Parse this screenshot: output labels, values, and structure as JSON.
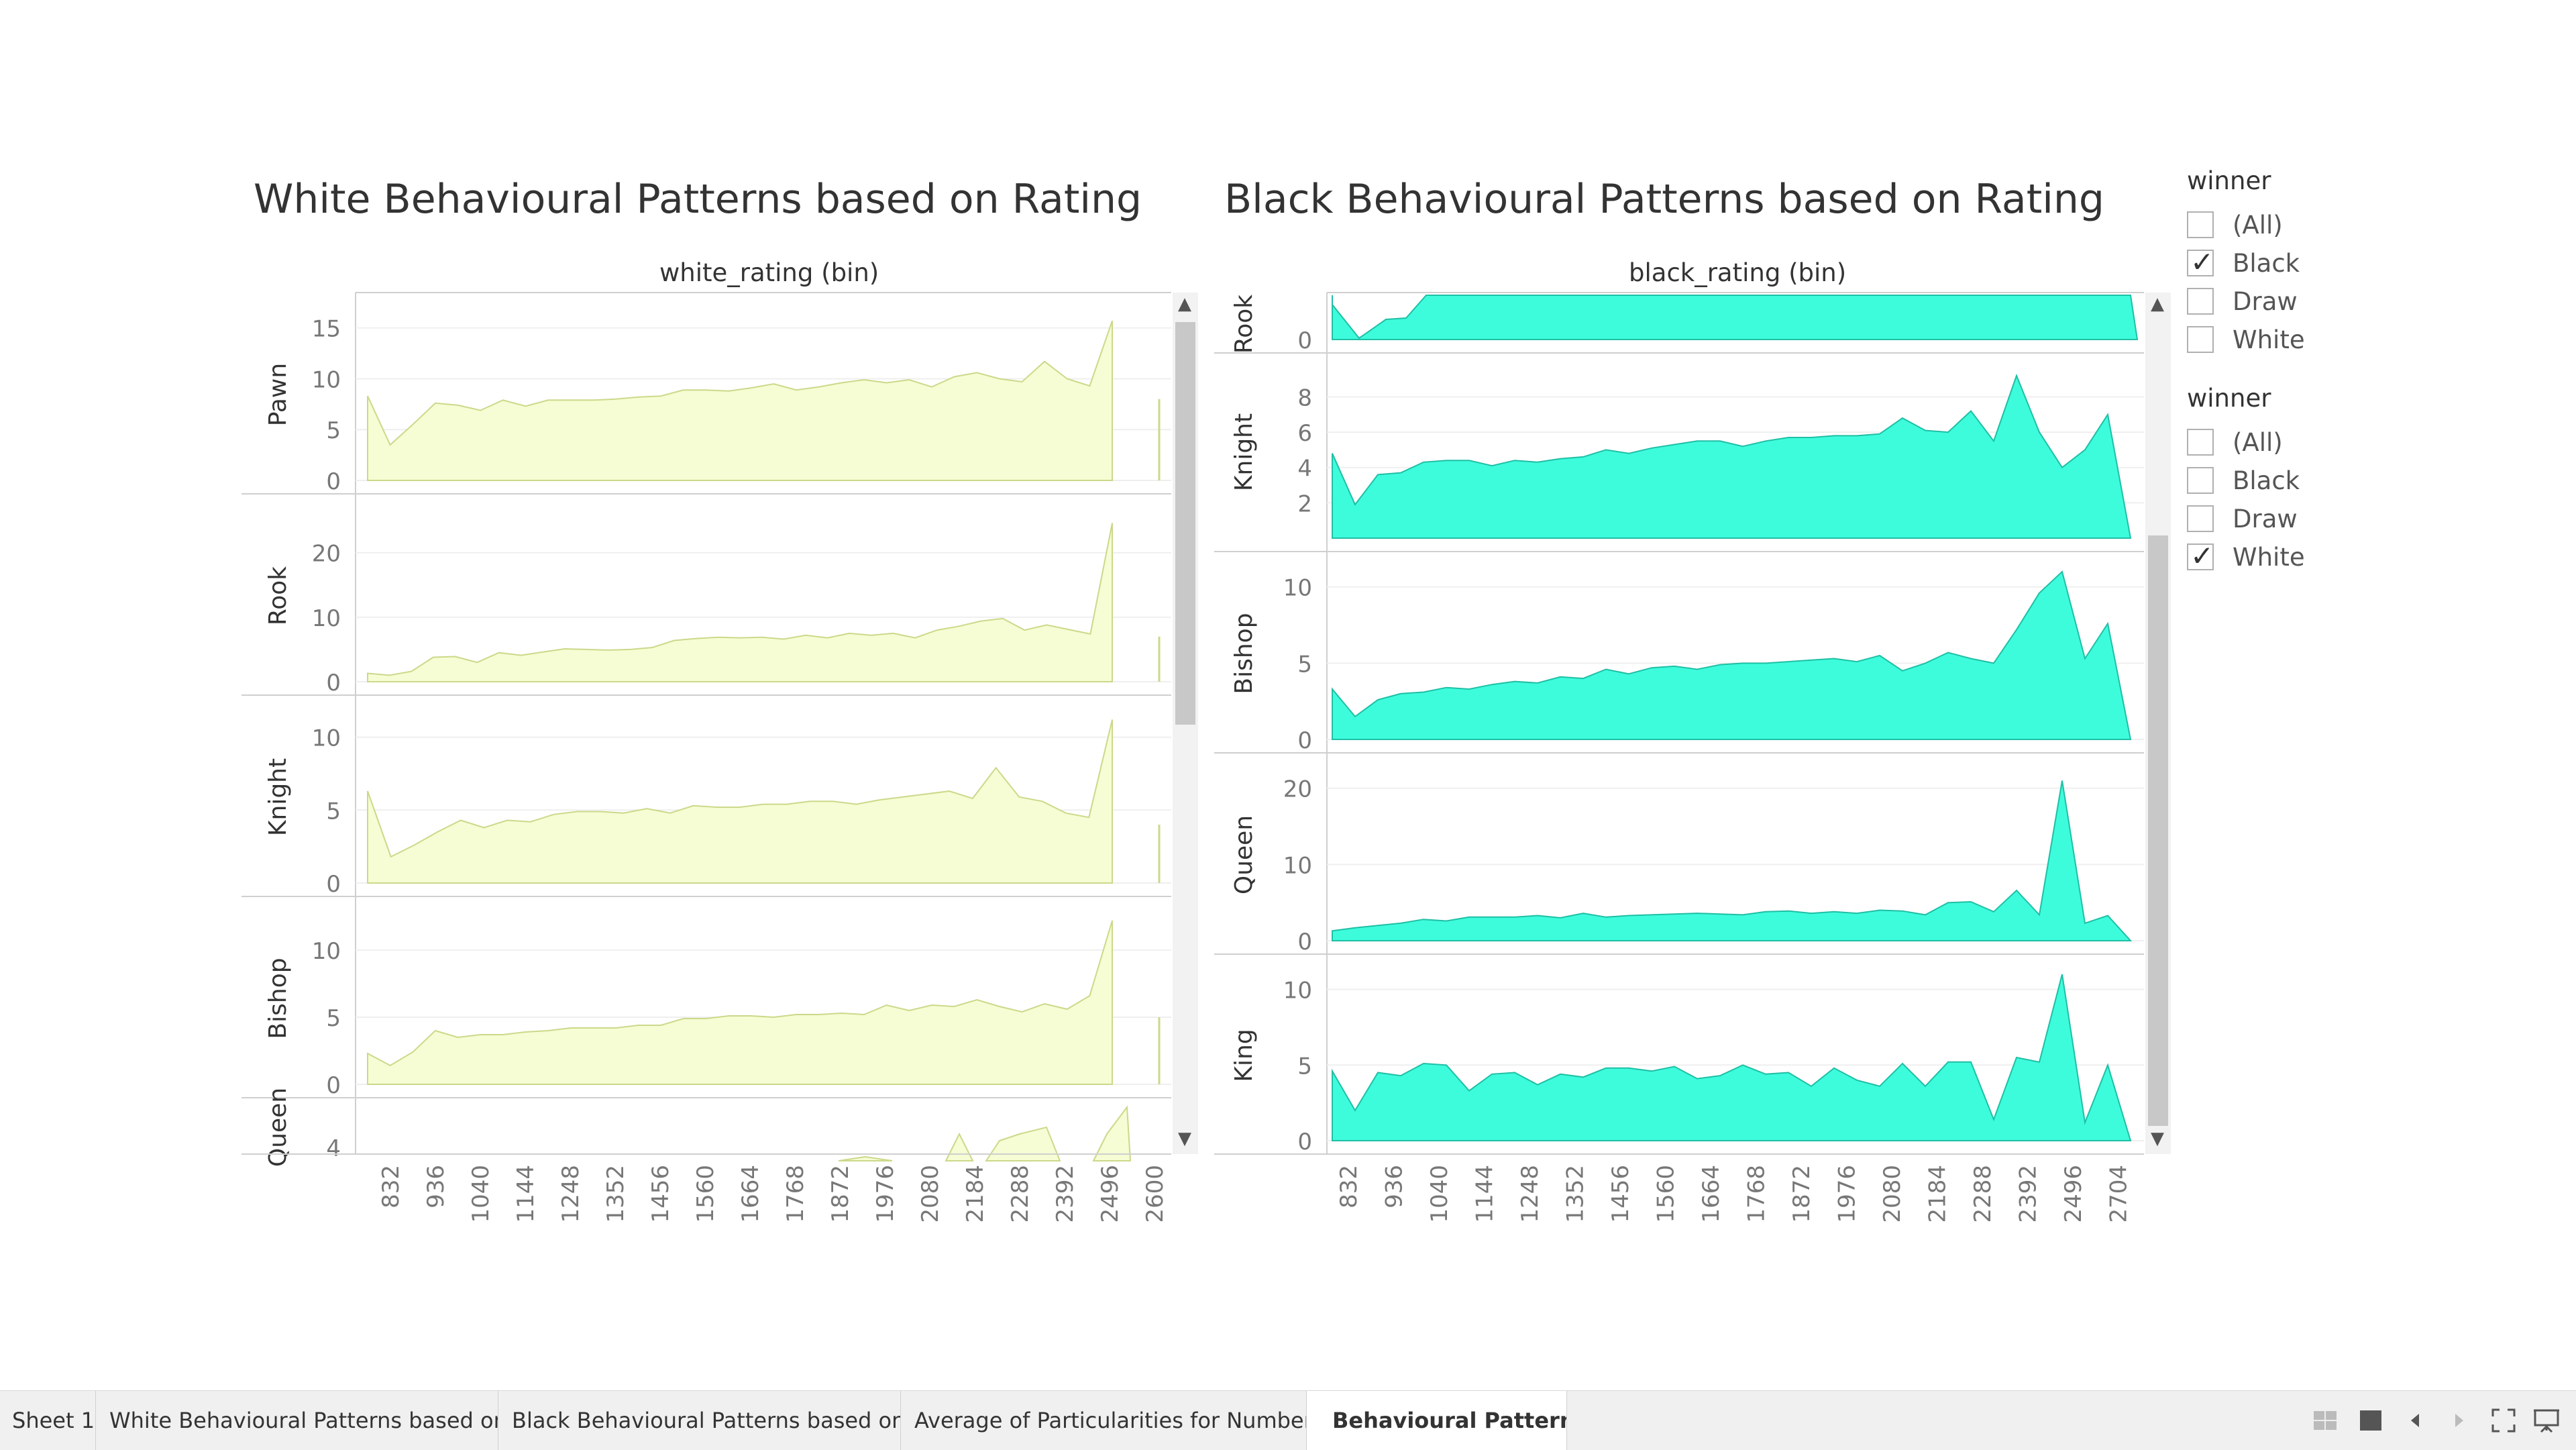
{
  "white_chart": {
    "title": "White Behavioural Patterns based on Rating",
    "column_header": "white_rating (bin)",
    "fill": "#f6fcd3",
    "stroke": "#cbd98a",
    "x_ticks": [
      "832",
      "936",
      "1040",
      "1144",
      "1248",
      "1352",
      "1456",
      "1560",
      "1664",
      "1768",
      "1872",
      "1976",
      "2080",
      "2184",
      "2288",
      "2392",
      "2496",
      "2600"
    ],
    "rows": [
      {
        "label": "Pawn",
        "yticks": [
          0,
          5,
          10,
          15
        ],
        "ymax": 16.5,
        "values": [
          8.3,
          3.5,
          5.5,
          7.6,
          7.4,
          6.9,
          7.9,
          7.3,
          7.9,
          7.9,
          7.9,
          8.0,
          8.2,
          8.3,
          8.9,
          8.9,
          8.8,
          9.1,
          9.5,
          8.9,
          9.2,
          9.6,
          9.9,
          9.6,
          9.9,
          9.2,
          10.2,
          10.6,
          10.0,
          9.7,
          11.7,
          10.0,
          9.3,
          15.7
        ],
        "spike": 8.0
      },
      {
        "label": "Rook",
        "yticks": [
          0,
          10,
          20
        ],
        "ymax": 26,
        "values": [
          1.3,
          1.0,
          1.6,
          3.8,
          3.9,
          3.0,
          4.5,
          4.1,
          4.6,
          5.1,
          5.0,
          4.9,
          5.0,
          5.3,
          6.4,
          6.7,
          6.9,
          6.8,
          6.9,
          6.6,
          7.2,
          6.8,
          7.5,
          7.2,
          7.5,
          6.8,
          8.0,
          8.6,
          9.4,
          9.8,
          8.0,
          8.8,
          8.1,
          7.4,
          24.6
        ],
        "spike": 7.0
      },
      {
        "label": "Knight",
        "yticks": [
          0,
          5,
          10
        ],
        "ymax": 11.5,
        "values": [
          6.3,
          1.8,
          2.6,
          3.5,
          4.3,
          3.8,
          4.3,
          4.2,
          4.7,
          4.9,
          4.9,
          4.8,
          5.1,
          4.8,
          5.3,
          5.2,
          5.2,
          5.4,
          5.4,
          5.6,
          5.6,
          5.4,
          5.7,
          5.9,
          6.1,
          6.3,
          5.8,
          7.9,
          5.9,
          5.6,
          4.8,
          4.5,
          11.2
        ],
        "spike": 4.0
      },
      {
        "label": "Bishop",
        "yticks": [
          0,
          5,
          10
        ],
        "ymax": 12.5,
        "values": [
          2.3,
          1.4,
          2.4,
          4.0,
          3.5,
          3.7,
          3.7,
          3.9,
          4.0,
          4.2,
          4.2,
          4.2,
          4.4,
          4.4,
          4.9,
          4.9,
          5.1,
          5.1,
          5.0,
          5.2,
          5.2,
          5.3,
          5.2,
          5.9,
          5.5,
          5.9,
          5.8,
          6.3,
          5.8,
          5.4,
          6.0,
          5.6,
          6.6,
          12.2
        ],
        "spike": 5.0
      },
      {
        "label": "Queen",
        "yticks": [
          4
        ],
        "partial": true
      }
    ]
  },
  "black_chart": {
    "title": "Black Behavioural Patterns based on Rating",
    "column_header": "black_rating (bin)",
    "fill": "#3dfcdc",
    "stroke": "#1fbfa5",
    "x_ticks": [
      "832",
      "936",
      "1040",
      "1144",
      "1248",
      "1352",
      "1456",
      "1560",
      "1664",
      "1768",
      "1872",
      "1976",
      "2080",
      "2184",
      "2288",
      "2392",
      "2496",
      "2704"
    ],
    "rows": [
      {
        "label": "Rook",
        "yticks": [
          0
        ],
        "partial_top": true
      },
      {
        "label": "Knight",
        "yticks": [
          2,
          4,
          6,
          8
        ],
        "ymax": 9.5,
        "values": [
          4.8,
          1.9,
          3.6,
          3.7,
          4.3,
          4.4,
          4.4,
          4.1,
          4.4,
          4.3,
          4.5,
          4.6,
          5.0,
          4.8,
          5.1,
          5.3,
          5.5,
          5.5,
          5.2,
          5.5,
          5.7,
          5.7,
          5.8,
          5.8,
          5.9,
          6.8,
          6.1,
          6.0,
          7.2,
          5.5,
          9.2,
          6.0,
          4.0,
          5.0,
          7.0,
          0.0
        ]
      },
      {
        "label": "Bishop",
        "yticks": [
          0,
          5,
          10
        ],
        "ymax": 11,
        "values": [
          3.3,
          1.5,
          2.6,
          3.0,
          3.1,
          3.4,
          3.3,
          3.6,
          3.8,
          3.7,
          4.1,
          4.0,
          4.6,
          4.3,
          4.7,
          4.8,
          4.6,
          4.9,
          5.0,
          5.0,
          5.1,
          5.2,
          5.3,
          5.1,
          5.5,
          4.5,
          5.0,
          5.7,
          5.3,
          5.0,
          7.2,
          9.6,
          11.0,
          5.3,
          7.6,
          0.0
        ]
      },
      {
        "label": "Queen",
        "yticks": [
          0,
          10,
          20
        ],
        "ymax": 22,
        "values": [
          1.3,
          1.7,
          2.0,
          2.3,
          2.8,
          2.6,
          3.1,
          3.1,
          3.1,
          3.3,
          3.0,
          3.6,
          3.1,
          3.3,
          3.4,
          3.5,
          3.6,
          3.5,
          3.4,
          3.8,
          3.9,
          3.6,
          3.8,
          3.6,
          4.0,
          3.9,
          3.4,
          5.0,
          5.1,
          3.8,
          6.6,
          3.4,
          21.0,
          2.3,
          3.3,
          0.0
        ]
      },
      {
        "label": "King",
        "yticks": [
          0,
          5,
          10
        ],
        "ymax": 11,
        "values": [
          4.6,
          2.0,
          4.5,
          4.3,
          5.1,
          5.0,
          3.3,
          4.4,
          4.5,
          3.7,
          4.4,
          4.2,
          4.8,
          4.8,
          4.6,
          4.9,
          4.1,
          4.3,
          5.0,
          4.4,
          4.5,
          3.6,
          4.8,
          4.0,
          3.6,
          5.1,
          3.6,
          5.2,
          5.2,
          1.4,
          5.5,
          5.2,
          11.0,
          1.2,
          5.0,
          0.0
        ]
      }
    ]
  },
  "filters": [
    {
      "title": "winner",
      "items": [
        {
          "label": "(All)",
          "checked": false
        },
        {
          "label": "Black",
          "checked": true
        },
        {
          "label": "Draw",
          "checked": false
        },
        {
          "label": "White",
          "checked": false
        }
      ]
    },
    {
      "title": "winner",
      "items": [
        {
          "label": "(All)",
          "checked": false
        },
        {
          "label": "Black",
          "checked": false
        },
        {
          "label": "Draw",
          "checked": false
        },
        {
          "label": "White",
          "checked": true
        }
      ]
    }
  ],
  "tabs": [
    {
      "label": "Sheet 1",
      "active": false
    },
    {
      "label": "White Behavioural Patterns based on R...",
      "active": false
    },
    {
      "label": "Black Behavioural Patterns based on R...",
      "active": false
    },
    {
      "label": "Average of Particularities for Number o...",
      "active": false
    },
    {
      "label": "Behavioural Patterns",
      "active": true
    }
  ]
}
